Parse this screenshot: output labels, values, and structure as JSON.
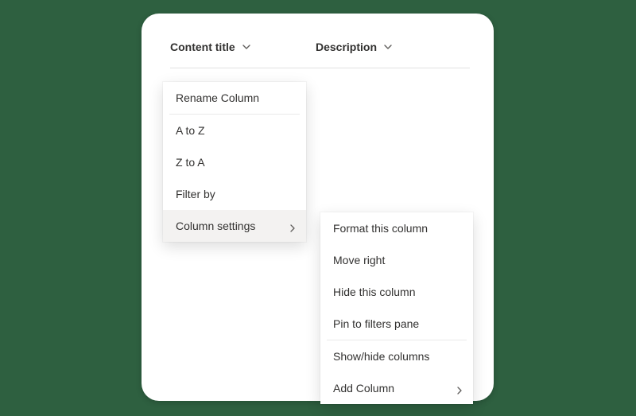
{
  "columns": [
    {
      "label": "Content title"
    },
    {
      "label": "Description"
    }
  ],
  "column_menu": {
    "rename": "Rename Column",
    "sort_asc": "A to Z",
    "sort_desc": "Z to A",
    "filter_by": "Filter by",
    "column_settings": "Column settings"
  },
  "column_settings_submenu": {
    "format": "Format this column",
    "move_right": "Move right",
    "hide": "Hide this column",
    "pin_filters": "Pin to filters pane",
    "show_hide": "Show/hide columns",
    "add_column": "Add Column"
  }
}
